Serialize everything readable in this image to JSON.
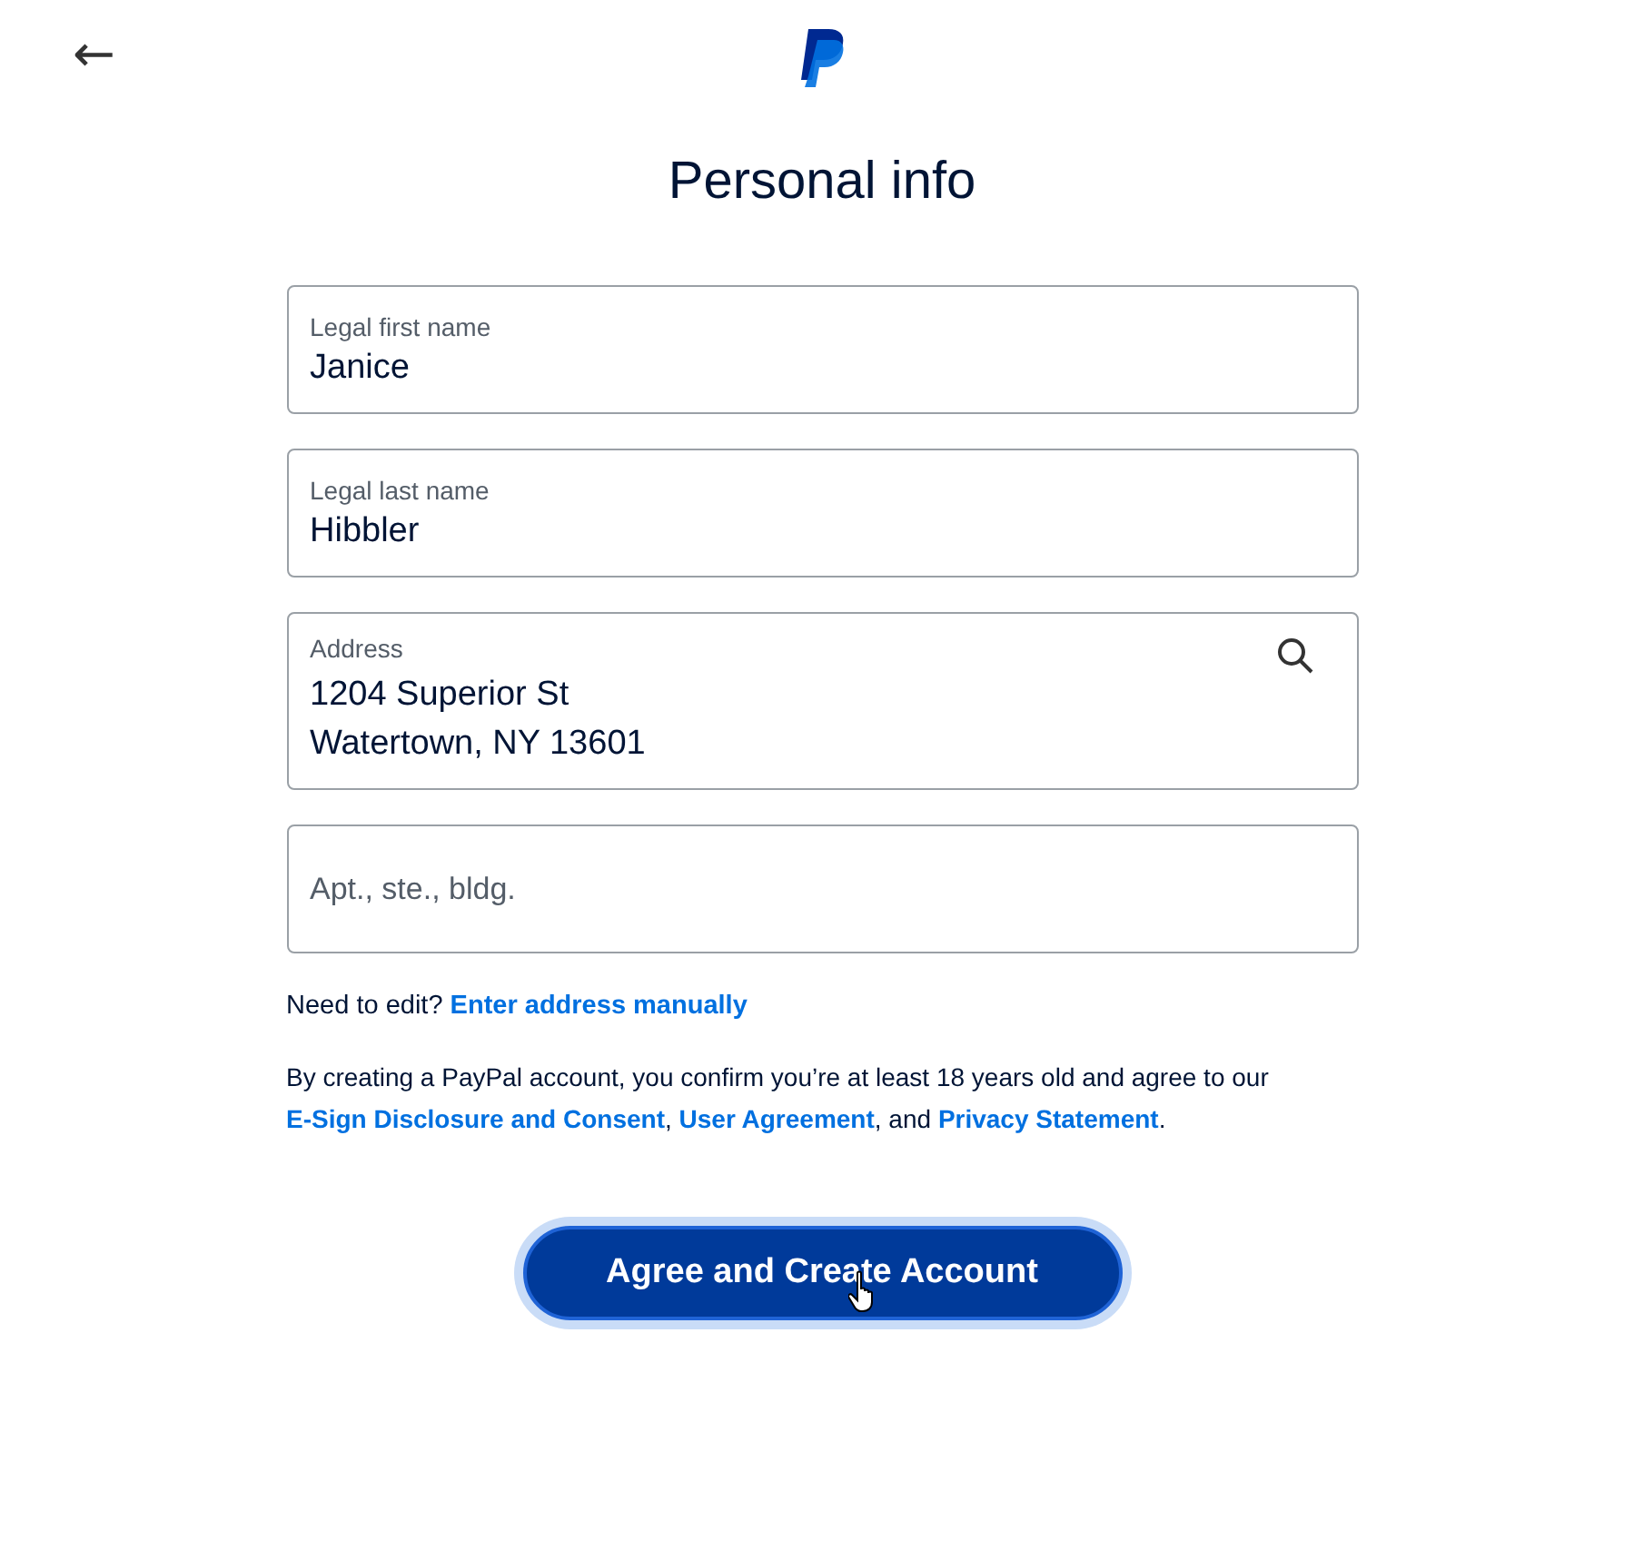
{
  "header": {
    "back": "←"
  },
  "title": "Personal info",
  "fields": [
    {
      "kind": "text",
      "label": "Legal first name",
      "value": "Janice"
    },
    {
      "kind": "text",
      "label": "Legal last name",
      "value": "Hibbler"
    },
    {
      "kind": "address",
      "label": "Address",
      "value": "1204 Superior St\nWatertown, NY 13601"
    },
    {
      "kind": "empty",
      "placeholder": "Apt., ste., bldg."
    }
  ],
  "edit_note": {
    "text": "Need to edit?",
    "link": "Enter address manually"
  },
  "legal": [
    {
      "kind": "text",
      "text": "By creating a PayPal account, you confirm you’re at least 18 years old and agree to our "
    },
    {
      "kind": "link",
      "text": "E-Sign Disclosure and Consent"
    },
    {
      "kind": "text",
      "text": ", "
    },
    {
      "kind": "link",
      "text": "User Agreement"
    },
    {
      "kind": "text",
      "text": ", and "
    },
    {
      "kind": "link",
      "text": "Privacy Statement"
    },
    {
      "kind": "text",
      "text": "."
    }
  ],
  "submit": {
    "label": "Agree and Create Account",
    "hovered": true
  }
}
